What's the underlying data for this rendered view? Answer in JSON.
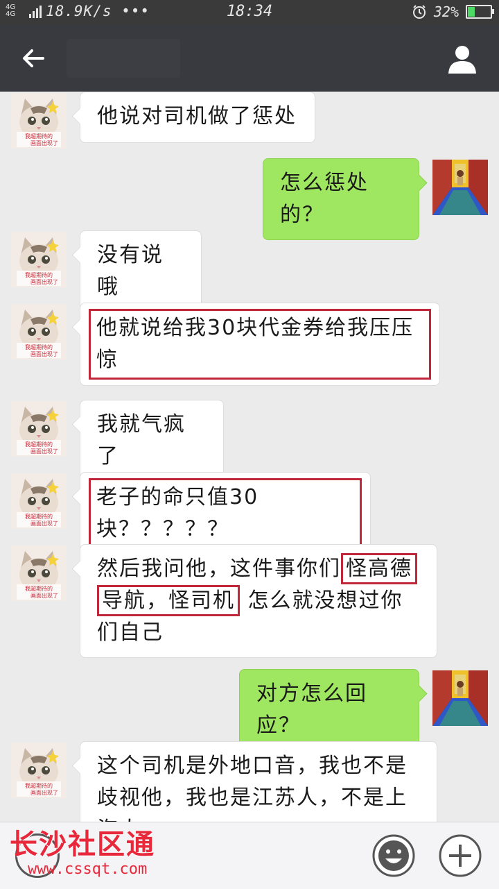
{
  "status_bar": {
    "network": "4G 4G",
    "speed": "18.9K/s •••",
    "time": "18:34",
    "battery_percent": "32%",
    "battery_level": 0.32
  },
  "titlebar": {
    "title": ""
  },
  "messages": [
    {
      "side": "left",
      "segments": [
        {
          "text": "他说对司机做了惩处",
          "boxed": false
        }
      ]
    },
    {
      "side": "right",
      "segments": [
        {
          "text": "怎么惩处的？",
          "boxed": false
        }
      ]
    },
    {
      "side": "left",
      "segments": [
        {
          "text": "没有说哦",
          "boxed": false
        }
      ]
    },
    {
      "side": "left",
      "segments": [
        {
          "text": "他就说给我30块代金券给我压压惊",
          "boxed": true
        }
      ]
    },
    {
      "side": "left",
      "segments": [
        {
          "text": "我就气疯了",
          "boxed": false
        }
      ]
    },
    {
      "side": "left",
      "segments": [
        {
          "text": "老子的命只值30块？？？？？",
          "boxed": true
        }
      ]
    },
    {
      "side": "left",
      "segments": [
        {
          "text": "然后我问他，这件事你们",
          "boxed": false
        },
        {
          "text": "怪高德导航，怪司机",
          "boxed": true
        },
        {
          "text": " 怎么就没想过你们自己",
          "boxed": false
        }
      ]
    },
    {
      "side": "right",
      "segments": [
        {
          "text": "对方怎么回应？",
          "boxed": false
        }
      ]
    },
    {
      "side": "left",
      "segments": [
        {
          "text": "这个司机是外地口音，我也不是歧视他，我也是江苏人，不是上海人。",
          "boxed": false
        }
      ]
    }
  ],
  "avatar_caption": [
    "我超期待的",
    "画面出现了"
  ],
  "watermark": {
    "name": "长沙社区通",
    "url": "www.cssqt.com"
  },
  "colors": {
    "bubble_self": "#9fe760",
    "highlight_box": "#c0283a",
    "titlebar": "#393a3f"
  }
}
